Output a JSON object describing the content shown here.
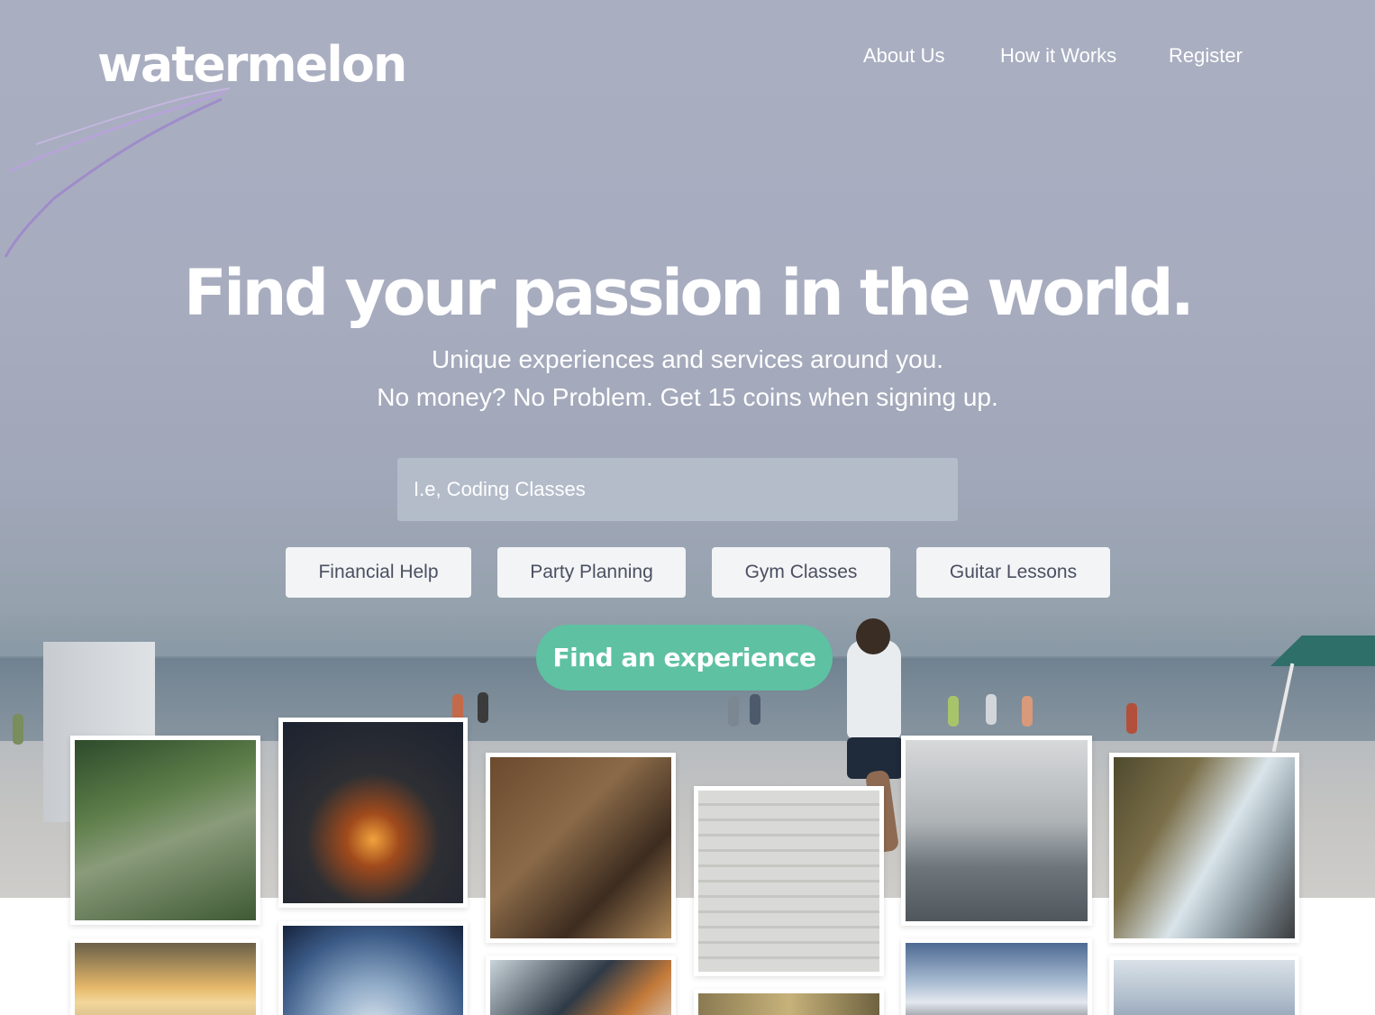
{
  "nav": {
    "logo": "watermelon",
    "links": [
      "About Us",
      "How it Works",
      "Register"
    ]
  },
  "hero": {
    "headline": "Find your passion in the world.",
    "subline1": "Unique experiences and services around you.",
    "subline2": "No money? No Problem. Get 15 coins when signing up."
  },
  "search": {
    "placeholder": "I.e, Coding Classes",
    "value": ""
  },
  "categories": [
    "Financial Help",
    "Party Planning",
    "Gym Classes",
    "Guitar Lessons"
  ],
  "cta": {
    "label": "Find an experience"
  },
  "colors": {
    "accent": "#5ec1a1",
    "chip_bg": "#f3f4f6",
    "chip_text": "#4a5060",
    "hero_sky": "#a9aec1"
  },
  "gallery": [
    {
      "subject": "hiker in forest"
    },
    {
      "subject": "campfire at night"
    },
    {
      "subject": "potter at wheel"
    },
    {
      "subject": "man sitting on stairs"
    },
    {
      "subject": "airplane wing over sea"
    },
    {
      "subject": "waterfall and cliffs"
    },
    {
      "subject": "sunset over clouds"
    },
    {
      "subject": "earth from space"
    },
    {
      "subject": "hands crafting"
    },
    {
      "subject": "old map"
    },
    {
      "subject": "mountains through window"
    },
    {
      "subject": "ocean horizon"
    }
  ]
}
